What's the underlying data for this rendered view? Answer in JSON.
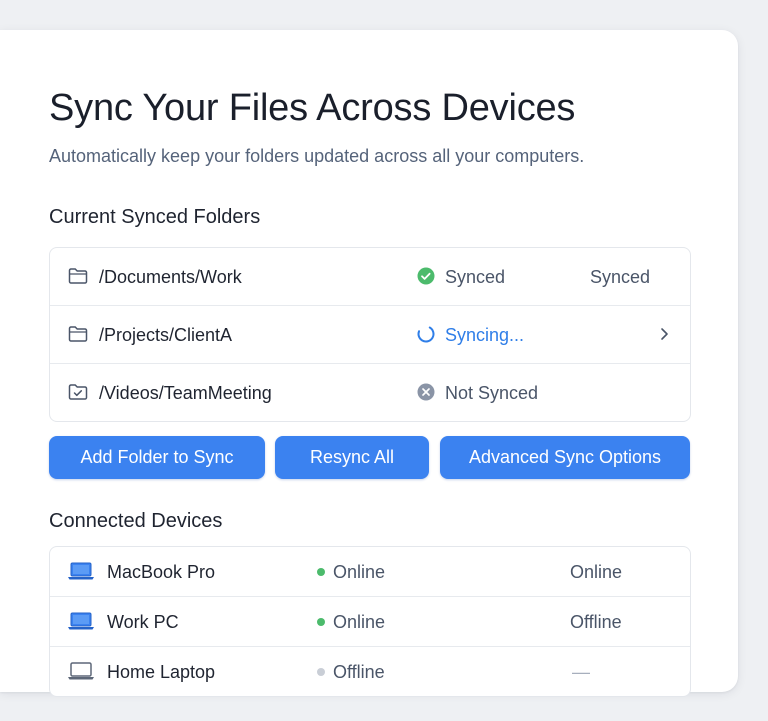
{
  "header": {
    "title": "Sync Your Files Across Devices",
    "subtitle": "Automatically keep your folders updated across all your computers."
  },
  "folders": {
    "section_title": "Current Synced Folders",
    "items": [
      {
        "path": "/Documents/Work",
        "status": "Synced",
        "status_icon": "check-circle-icon",
        "right": "Synced"
      },
      {
        "path": "/Projects/ClientA",
        "status": "Syncing...",
        "status_icon": "spinner-icon",
        "right_icon": "chevron-right-icon"
      },
      {
        "path": "/Videos/TeamMeeting",
        "status": "Not Synced",
        "status_icon": "x-circle-icon",
        "folder_icon": "folder-check-icon"
      }
    ]
  },
  "actions": {
    "add_folder": "Add Folder to Sync",
    "resync_all": "Resync All",
    "advanced": "Advanced Sync Options"
  },
  "devices": {
    "section_title": "Connected Devices",
    "items": [
      {
        "name": "MacBook Pro",
        "status": "Online",
        "right": "Online"
      },
      {
        "name": "Work PC",
        "status": "Online",
        "right": "Offline"
      },
      {
        "name": "Home Laptop",
        "status": "Offline",
        "right": "—"
      }
    ]
  },
  "colors": {
    "accent": "#3b82f0",
    "synced_green": "#4cbb6c",
    "syncing_blue": "#2f7ee8",
    "not_synced_gray": "#8a94a6",
    "online_dot": "#4cbb6c",
    "offline_dot": "#c9ced6"
  }
}
